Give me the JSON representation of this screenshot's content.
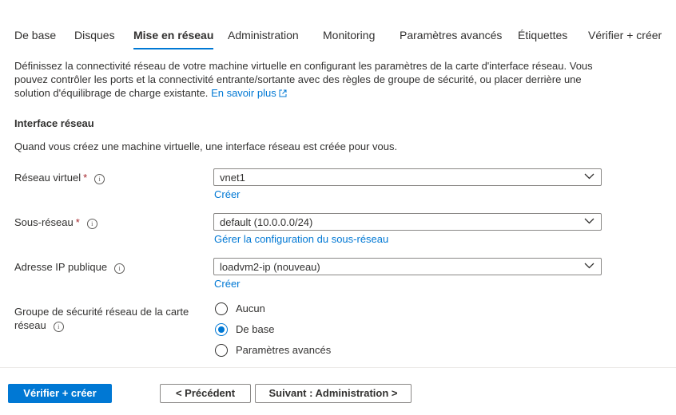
{
  "tabs": [
    {
      "label": "De base"
    },
    {
      "label": "Disques"
    },
    {
      "label": "Mise en réseau",
      "active": true
    },
    {
      "label": "Administration"
    },
    {
      "label": "Monitoring"
    },
    {
      "label": "Paramètres avancés"
    },
    {
      "label": "Étiquettes"
    },
    {
      "label": "Vérifier + créer"
    }
  ],
  "intro": {
    "text": "Définissez la connectivité réseau de votre machine virtuelle en configurant les paramètres de la carte d'interface réseau. Vous pouvez contrôler les ports et la connectivité entrante/sortante avec des règles de groupe de sécurité, ou placer derrière une solution d'équilibrage de charge existante.",
    "learn_more": "En savoir plus"
  },
  "section": {
    "title": "Interface réseau",
    "description": "Quand vous créez une machine virtuelle, une interface réseau est créée pour vous."
  },
  "fields": {
    "vnet": {
      "label": "Réseau virtuel",
      "required": "*",
      "value": "vnet1",
      "link": "Créer"
    },
    "subnet": {
      "label": "Sous-réseau",
      "required": "*",
      "value": "default (10.0.0.0/24)",
      "link": "Gérer la configuration du sous-réseau"
    },
    "public_ip": {
      "label": "Adresse IP publique",
      "value": "loadvm2-ip (nouveau)",
      "link": "Créer"
    },
    "nsg": {
      "label_line1": "Groupe de sécurité réseau de la carte",
      "label_line2": "réseau",
      "options": [
        "Aucun",
        "De base",
        "Paramètres avancés"
      ],
      "selected": "De base"
    }
  },
  "footer": {
    "review_create": "Vérifier + créer",
    "previous": "< Précédent",
    "next": "Suivant : Administration >"
  },
  "colors": {
    "accent": "#0078d4",
    "required": "#a4262c",
    "text": "#323130"
  }
}
